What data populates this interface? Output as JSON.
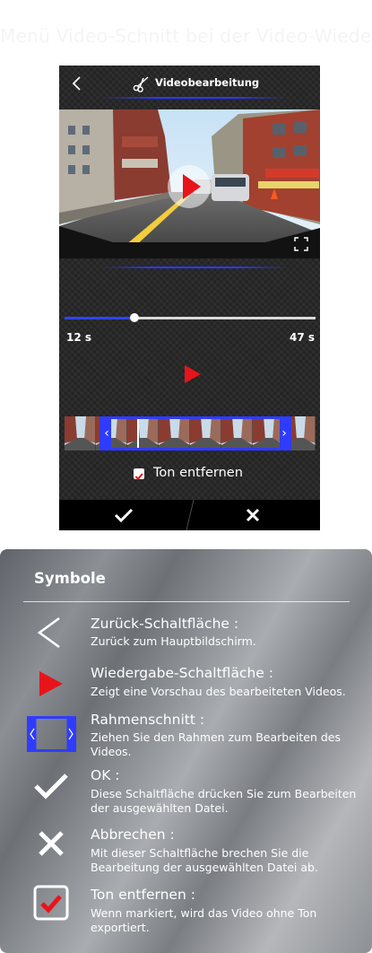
{
  "page_heading": "Menü Video-Schnitt bei der Video-Wiedergabe",
  "header": {
    "back_icon": "chevron-left-icon",
    "title_icon": "scissors-icon",
    "title": "Videobearbeitung"
  },
  "video": {
    "play_icon": "play-icon",
    "fullscreen_icon": "fullscreen-icon"
  },
  "trim": {
    "start_label": "12 s",
    "end_label": "47 s",
    "position_fraction": 0.28
  },
  "frame_strip": {
    "left_handle": "‹",
    "right_handle": "›"
  },
  "mute": {
    "label": "Ton entfernen",
    "checked": true
  },
  "bottom_bar": {
    "ok_icon": "checkmark-icon",
    "cancel_icon": "close-icon"
  },
  "symbols": {
    "title": "Symbole",
    "items": [
      {
        "icon": "chevron-left-icon",
        "title": "Zurück-Schaltfläche :",
        "desc": "Zurück zum Hauptbildschirm."
      },
      {
        "icon": "play-icon",
        "title": "Wiedergabe-Schaltfläche :",
        "desc": "Zeigt eine Vorschau des bearbeiteten Videos."
      },
      {
        "icon": "frame-trim-icon",
        "title": "Rahmenschnitt :",
        "desc": "Ziehen Sie den Rahmen zum Bearbeiten des Videos."
      },
      {
        "icon": "checkmark-icon",
        "title": "OK :",
        "desc": "Diese Schaltfläche drücken Sie zum Bearbeiten der ausgewählten Datei."
      },
      {
        "icon": "close-icon",
        "title": "Abbrechen :",
        "desc": "Mit dieser Schaltfläche brechen Sie die Bearbeitung der ausgewählten Datei ab."
      },
      {
        "icon": "checkbox-checked-icon",
        "title": "Ton entfernen :",
        "desc": "Wenn markiert, wird das Video ohne Ton exportiert."
      }
    ]
  },
  "colors": {
    "accent_blue": "#2f3cff",
    "play_red": "#e8141b",
    "phone_bg": "#232323"
  }
}
